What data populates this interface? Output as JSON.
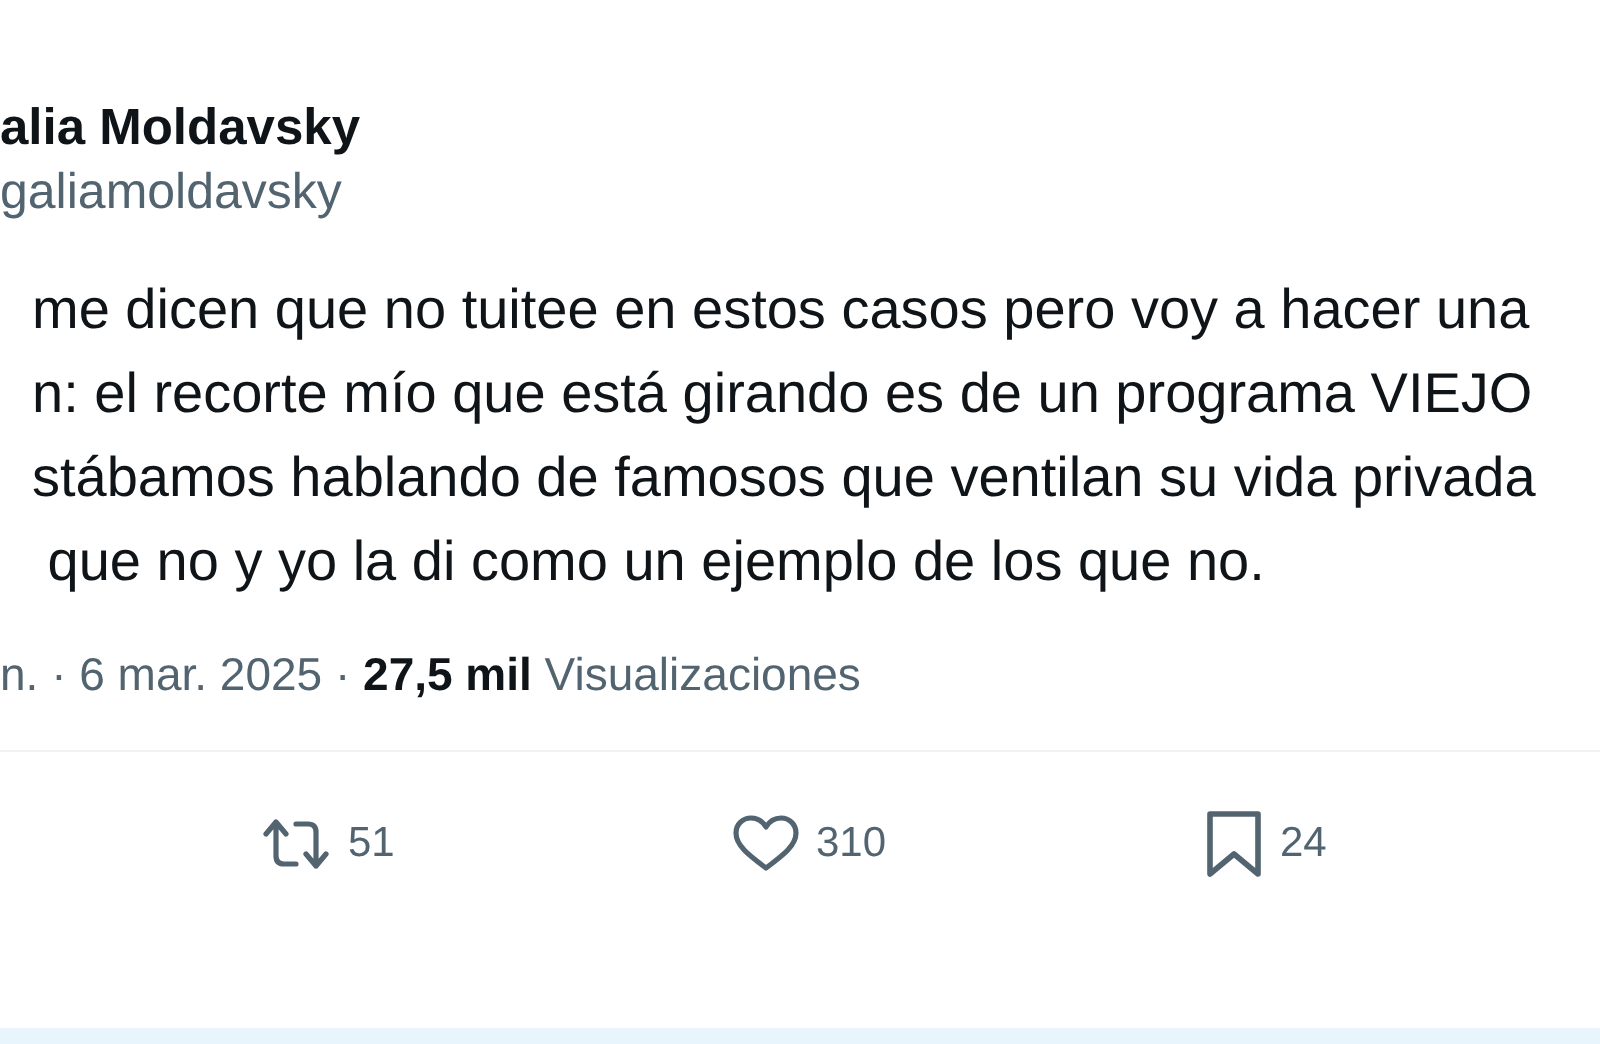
{
  "author": {
    "name": "alia Moldavsky",
    "handle": "galiamoldavsky"
  },
  "body": "me dicen que no tuitee en estos casos pero voy a hacer una\nn: el recorte mío que está girando es de un programa VIEJO\nstábamos hablando de famosos que ventilan su vida privada\n que no y yo la di como un ejemplo de los que no.",
  "meta": "n. · 6 mar. 2025 · **27,5 mil** Visualizaciones",
  "actions": [
    {
      "kind": "repost",
      "count": "51"
    },
    {
      "kind": "like",
      "count": "310"
    },
    {
      "kind": "bookmark",
      "count": "24"
    }
  ]
}
